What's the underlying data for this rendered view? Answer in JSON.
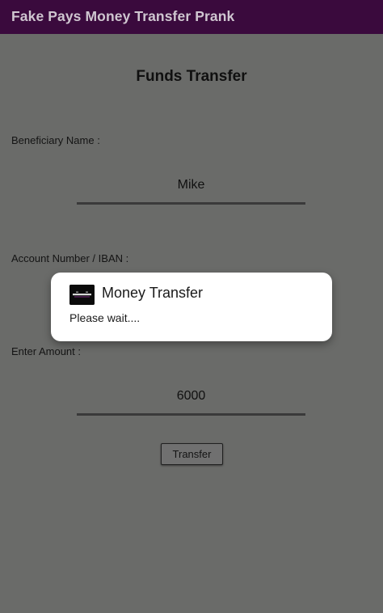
{
  "app_bar": {
    "title": "Fake Pays Money Transfer Prank"
  },
  "form": {
    "title": "Funds Transfer",
    "beneficiary_label": "Beneficiary Name :",
    "beneficiary_value": "Mike",
    "account_label": "Account Number / IBAN :",
    "account_value": "",
    "amount_label": "Enter Amount :",
    "amount_value": "6000",
    "transfer_button_label": "Transfer"
  },
  "dialog": {
    "icon": "app-logo-icon",
    "title": "Money Transfer",
    "message": "Please wait...."
  },
  "colors": {
    "app_bar": "#3a0a3d",
    "scrim_background": "#6a6b69",
    "dialog_background": "#ffffff"
  }
}
